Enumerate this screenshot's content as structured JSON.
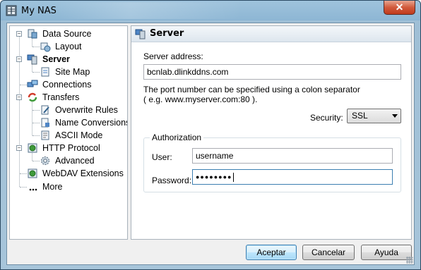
{
  "window": {
    "title": "My NAS",
    "close_glyph": "✕"
  },
  "tree": {
    "items": [
      {
        "label": "Data Source"
      },
      {
        "label": "Layout"
      },
      {
        "label": "Server"
      },
      {
        "label": "Site Map"
      },
      {
        "label": "Connections"
      },
      {
        "label": "Transfers"
      },
      {
        "label": "Overwrite Rules"
      },
      {
        "label": "Name Conversions"
      },
      {
        "label": "ASCII Mode"
      },
      {
        "label": "HTTP Protocol"
      },
      {
        "label": "Advanced"
      },
      {
        "label": "WebDAV Extensions"
      },
      {
        "label": "More"
      }
    ],
    "expander_minus": "−"
  },
  "panel": {
    "title": "Server",
    "server_address_label": "Server address:",
    "server_address_value": "bcnlab.dlinkddns.com",
    "hint_line1": "The port number can be specified using a colon separator",
    "hint_line2": "( e.g. www.myserver.com:80 ).",
    "security_label": "Security:",
    "security_value": "SSL",
    "auth_group_title": "Authorization",
    "user_label": "User:",
    "user_value": "username",
    "password_label": "Password:",
    "password_mask": "●●●●●●●●"
  },
  "buttons": {
    "ok": "Aceptar",
    "cancel": "Cancelar",
    "help": "Ayuda"
  },
  "colors": {
    "accent": "#3c7fb1",
    "title_bar": "#9fc3dc",
    "close": "#c03a1c"
  }
}
